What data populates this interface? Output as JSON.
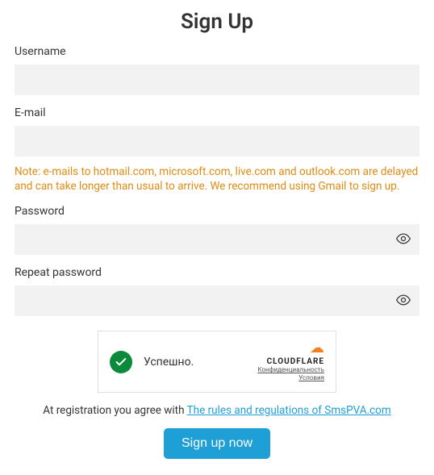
{
  "title": "Sign Up",
  "fields": {
    "username": {
      "label": "Username",
      "value": ""
    },
    "email": {
      "label": "E-mail",
      "value": ""
    },
    "password": {
      "label": "Password",
      "value": ""
    },
    "repeat_password": {
      "label": "Repeat password",
      "value": ""
    }
  },
  "note": "Note: e-mails to hotmail.com, microsoft.com, live.com and outlook.com are delayed and can take longer than usual to arrive. We recommend using Gmail to sign up.",
  "captcha": {
    "status": "Успешно.",
    "brand": "CLOUDFLARE",
    "privacy": "Конфиденциальность",
    "terms": "Условия"
  },
  "agree": {
    "prefix": "At registration you agree with ",
    "link": "The rules and regulations of SmsPVA.com"
  },
  "submit_label": "Sign up now"
}
